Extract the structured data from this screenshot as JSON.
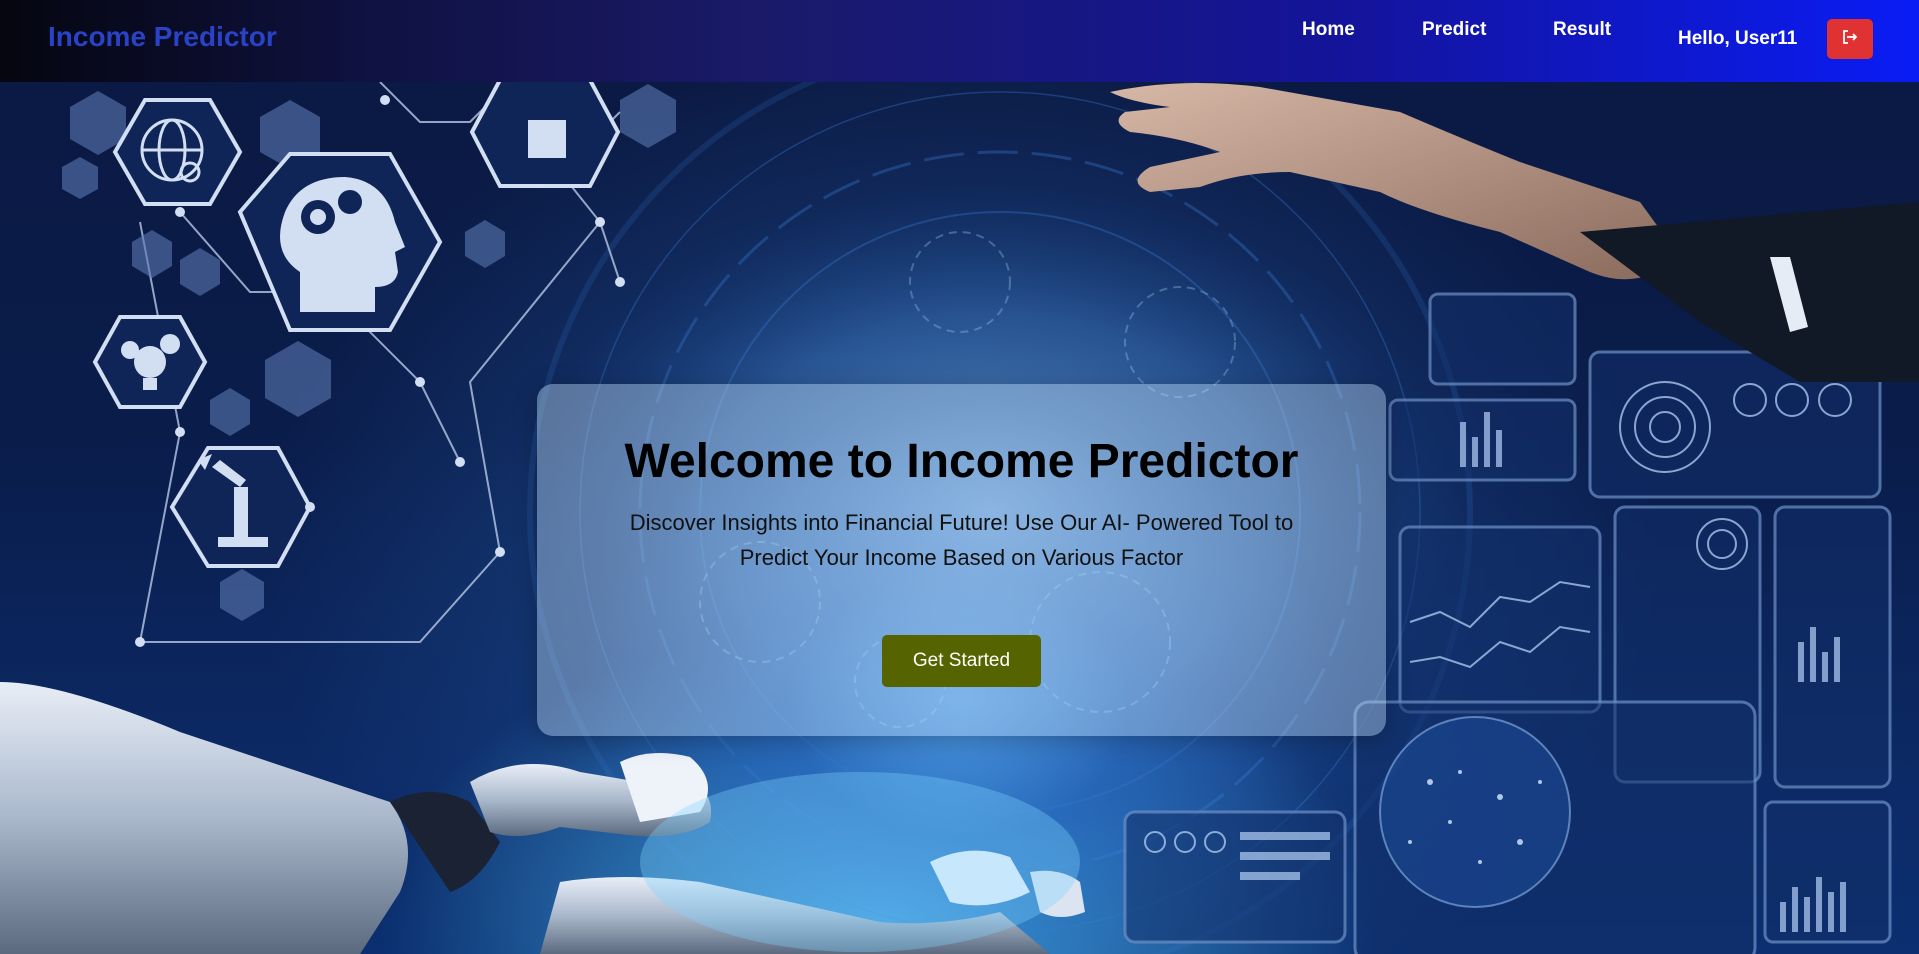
{
  "app": {
    "brand": "Income Predictor"
  },
  "nav": {
    "home_label": "Home",
    "predict_label": "Predict",
    "result_label": "Result",
    "greeting": "Hello, User11",
    "logout_icon": "logout-icon"
  },
  "hero": {
    "title": "Welcome to Income Predictor",
    "subtitle": "Discover Insights into Financial Future! Use Our AI- Powered Tool to Predict Your Income Based on Various Factor",
    "cta_label": "Get Started"
  },
  "colors": {
    "brand_text": "#2a43c6",
    "navbar_start": "#05060f",
    "navbar_end": "#0a1cf5",
    "logout_button": "#e03232",
    "cta_button": "#566400",
    "card_background": "rgba(190,220,245,0.42)"
  },
  "icons": [
    "logout-icon",
    "globe-icon",
    "head-gears-icon",
    "lightbulb-gears-icon",
    "robot-arm-icon",
    "chip-icon"
  ]
}
